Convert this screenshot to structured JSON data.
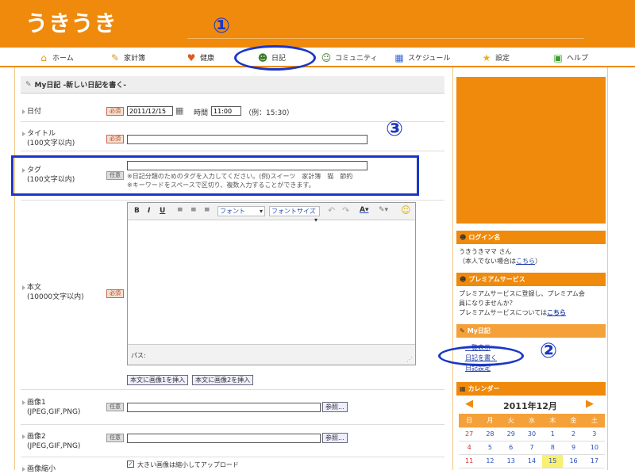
{
  "header": {
    "logo": "うきうき"
  },
  "nav": [
    {
      "label": "ホーム",
      "icon": "home-icon",
      "glyph": "⌂",
      "color": "#e8941a"
    },
    {
      "label": "家計簿",
      "icon": "pencil-icon",
      "glyph": "✎",
      "color": "#d49a2a"
    },
    {
      "label": "健康",
      "icon": "heart-icon",
      "glyph": "♥",
      "color": "#e05a1a"
    },
    {
      "label": "日記",
      "icon": "person-icon",
      "glyph": "☻",
      "color": "#3a7a2a"
    },
    {
      "label": "コミュニティ",
      "icon": "people-icon",
      "glyph": "☺",
      "color": "#3a7a2a"
    },
    {
      "label": "スケジュール",
      "icon": "calendar-icon",
      "glyph": "▦",
      "color": "#3a6ad0"
    },
    {
      "label": "設定",
      "icon": "star-icon",
      "glyph": "★",
      "color": "#e8b01a"
    },
    {
      "label": "ヘルプ",
      "icon": "help-icon",
      "glyph": "▣",
      "color": "#3aa02a"
    }
  ],
  "page_title": "My日記 -新しい日記を書く-",
  "form": {
    "date": {
      "label": "日付",
      "badge": "必須",
      "value": "2011/12/15",
      "time_label": "時間",
      "time_value": "11:00",
      "example": "（例：15:30）"
    },
    "title": {
      "label": "タイトル",
      "sub": "(100文字以内)",
      "badge": "必須"
    },
    "tag": {
      "label": "タグ",
      "sub": "(100文字以内)",
      "badge": "任意",
      "note1": "※日記分類のためのタグを入力してください。(例)スイーツ　家計簿　猫　節約",
      "note2": "※キーワードをスペースで区切り、複数入力することができます。"
    },
    "body": {
      "label": "本文",
      "sub": "(10000文字以内)",
      "badge": "必須",
      "font": "フォント",
      "fontsize": "フォントサイズ",
      "path": "パス:",
      "insert1": "本文に画像1を挿入",
      "insert2": "本文に画像2を挿入"
    },
    "image1": {
      "label": "画像1",
      "sub": "(JPEG,GIF,PNG)",
      "badge": "任意",
      "browse": "参照..."
    },
    "image2": {
      "label": "画像2",
      "sub": "(JPEG,GIF,PNG)",
      "badge": "任意",
      "browse": "参照..."
    },
    "image_shrink": {
      "label": "画像縮小",
      "checkbox": "大きい画像は縮小してアップロード"
    }
  },
  "sidebar": {
    "login": {
      "title": "ログイン名",
      "line1": "うきうきママ さん",
      "line2a": "（本人でない場合は",
      "line2link": "こちら",
      "line2b": "）"
    },
    "premium": {
      "title": "プレミアムサービス",
      "line1": "プレミアムサービスに登録し、プレミアム会",
      "line2": "員になりませんか？",
      "line3a": "プレミアムサービスについては",
      "line3link": "こちら"
    },
    "mydiary": {
      "title": "My日記",
      "items": [
        "一覧表示",
        "日記を書く",
        "日記設定"
      ]
    },
    "calendar": {
      "title": "カレンダー",
      "month": "2011年12月",
      "weekdays": [
        "日",
        "月",
        "火",
        "水",
        "木",
        "金",
        "土"
      ],
      "row1": [
        "27",
        "28",
        "29",
        "30",
        "1",
        "2",
        "3"
      ],
      "row2": [
        "4",
        "5",
        "6",
        "7",
        "8",
        "9",
        "10"
      ],
      "row3": [
        "11",
        "12",
        "13",
        "14",
        "15",
        "16",
        "17"
      ]
    }
  },
  "annotations": [
    "①",
    "②",
    "③"
  ],
  "colors": {
    "brand": "#ef8a0c",
    "annotation": "#1a37c7"
  }
}
